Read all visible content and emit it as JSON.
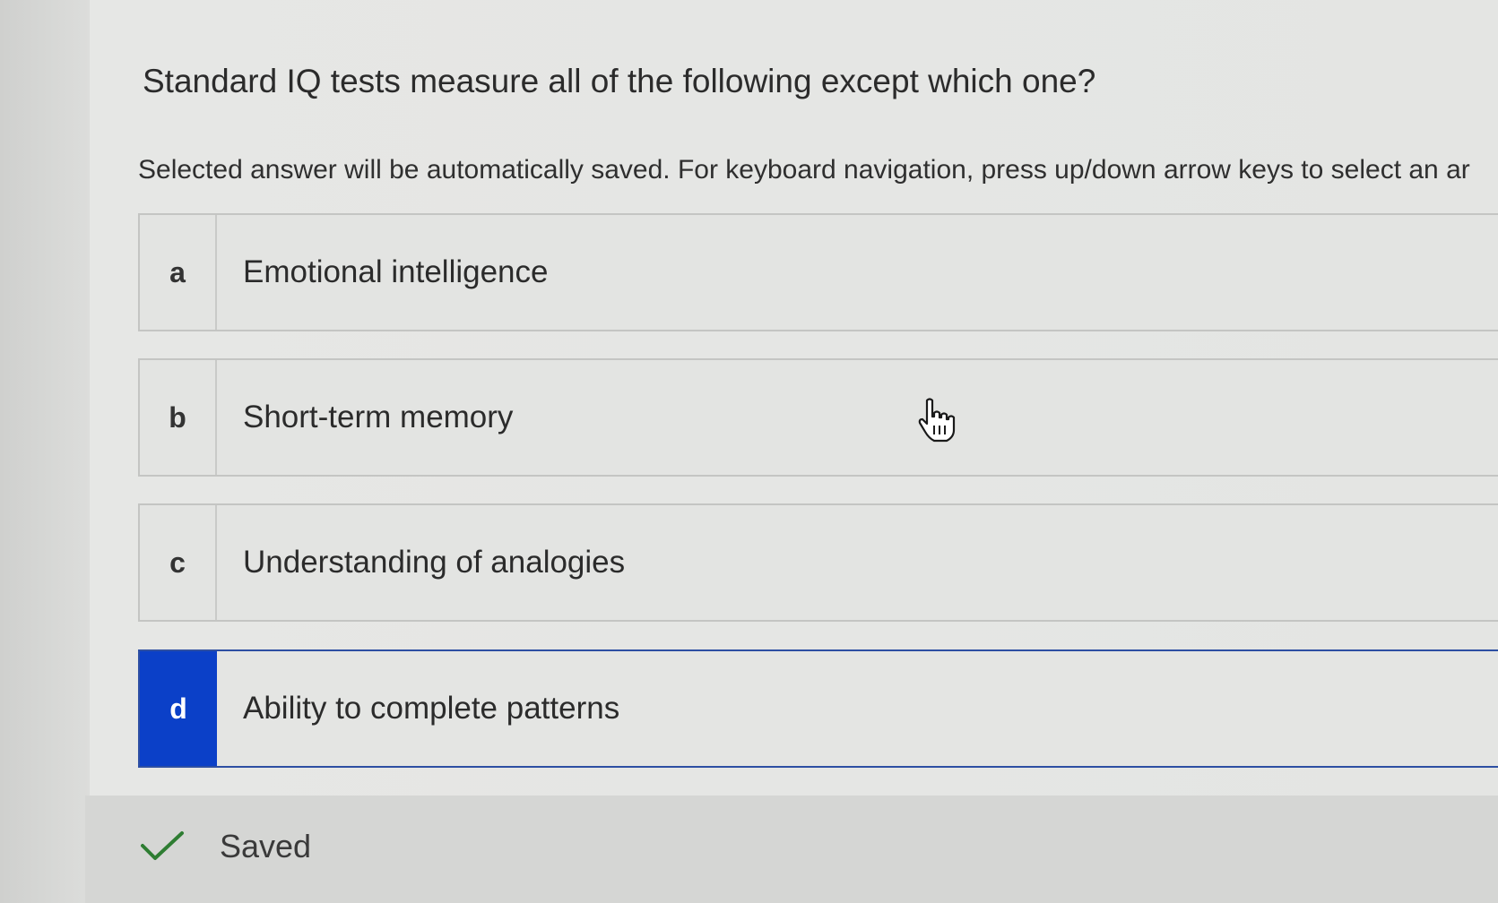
{
  "question": {
    "text": "Standard IQ tests measure all of the following except which one?"
  },
  "instruction": {
    "text": "Selected answer will be automatically saved. For keyboard navigation, press up/down arrow keys to select an ar"
  },
  "options": [
    {
      "letter": "a",
      "label": "Emotional intelligence",
      "selected": false
    },
    {
      "letter": "b",
      "label": "Short-term memory",
      "selected": false
    },
    {
      "letter": "c",
      "label": "Understanding of analogies",
      "selected": false
    },
    {
      "letter": "d",
      "label": "Ability to complete patterns",
      "selected": true
    }
  ],
  "status": {
    "saved_label": "Saved",
    "icon": "checkmark-icon"
  },
  "cursor": {
    "icon": "hand-pointer-icon"
  },
  "colors": {
    "selected_accent": "#0b40c8",
    "selected_border": "#2d4fa3",
    "check_green": "#2e7d32"
  }
}
